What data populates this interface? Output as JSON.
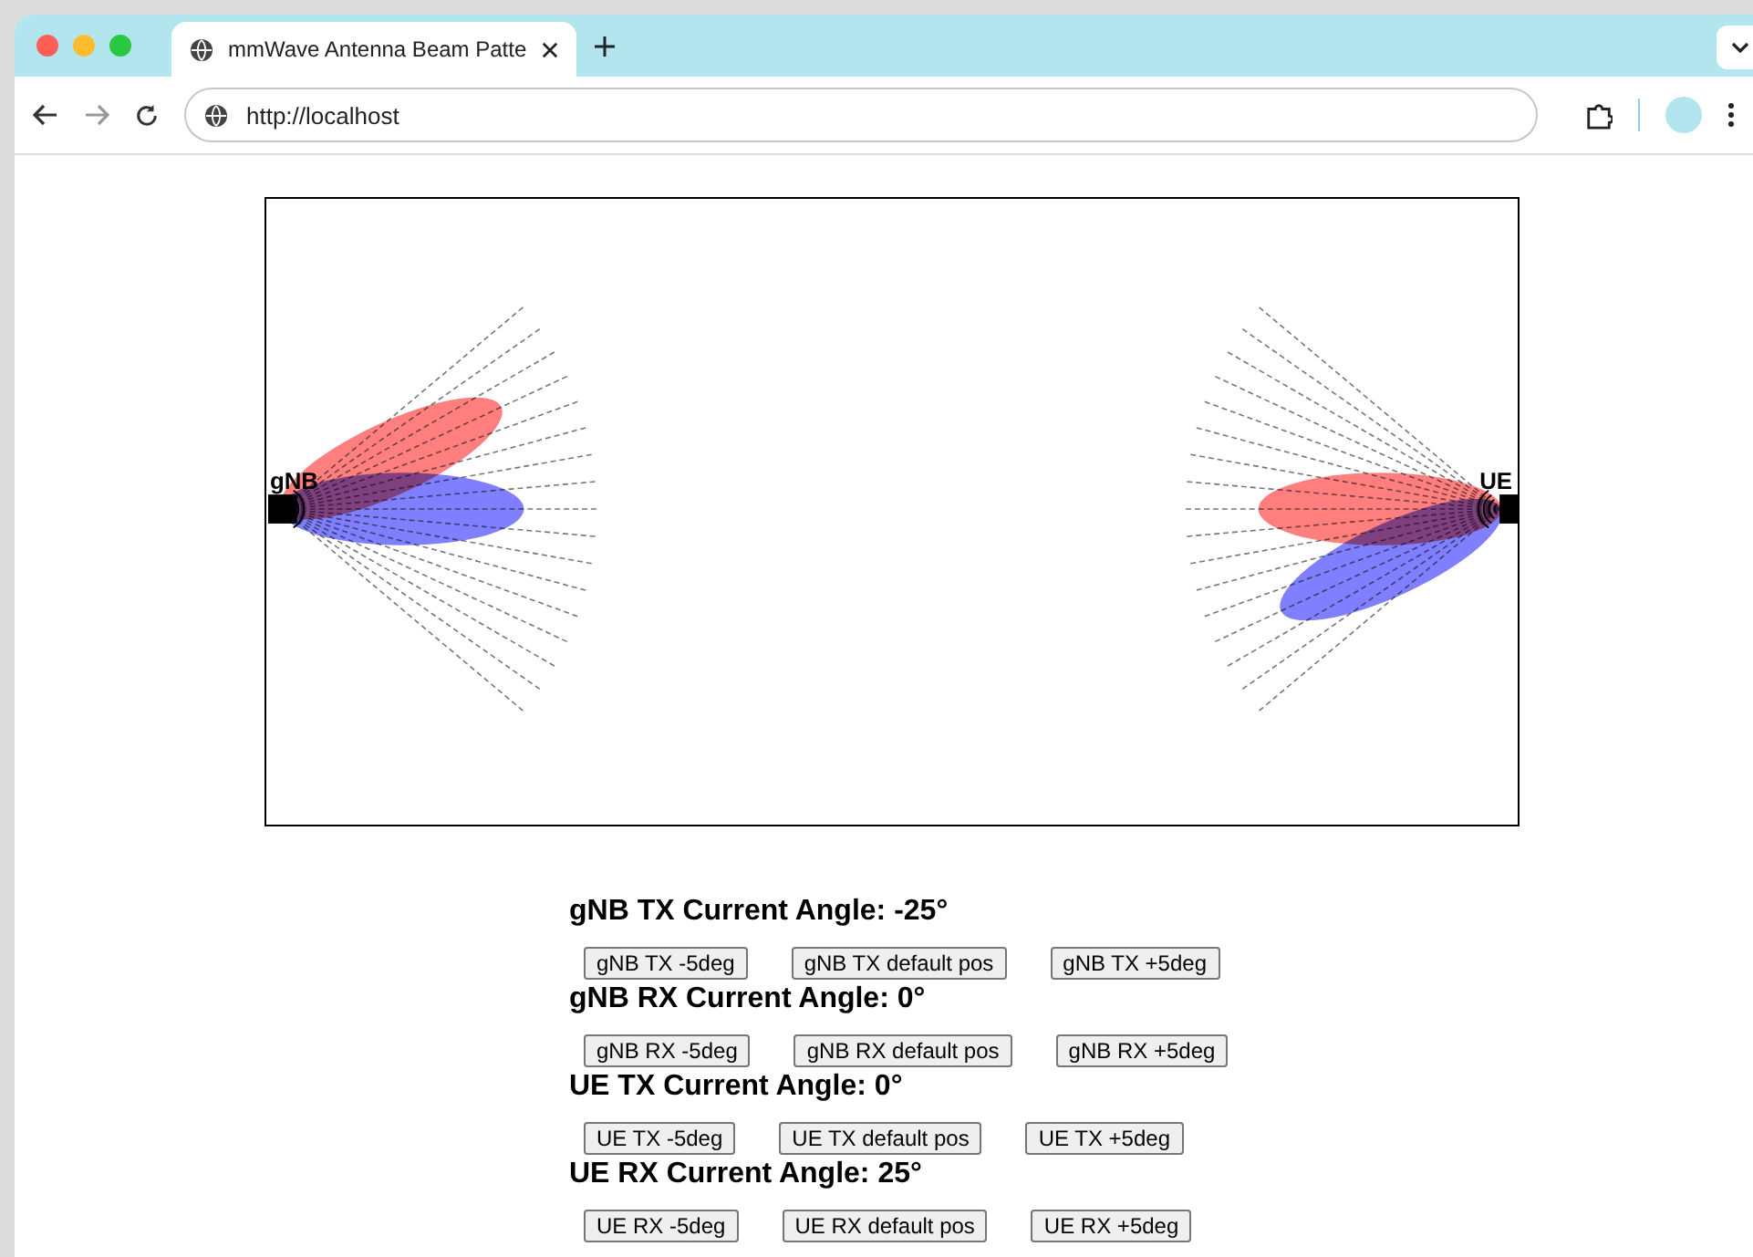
{
  "browser": {
    "tab_title": "mmWave Antenna Beam Patte",
    "url": "http://localhost"
  },
  "diagram": {
    "nodes": [
      {
        "label": "gNB"
      },
      {
        "label": "UE"
      }
    ]
  },
  "controls": [
    {
      "heading": "gNB TX Current Angle: -25°",
      "color": "#ff7f7f",
      "buttons": [
        "gNB TX -5deg",
        "gNB TX default pos",
        "gNB TX +5deg"
      ]
    },
    {
      "heading": "gNB RX Current Angle: 0°",
      "color": "#7f7fff",
      "buttons": [
        "gNB RX -5deg",
        "gNB RX default pos",
        "gNB RX +5deg"
      ]
    },
    {
      "heading": "UE TX Current Angle: 0°",
      "color": "#ff7f7f",
      "buttons": [
        "UE TX -5deg",
        "UE TX default pos",
        "UE TX +5deg"
      ]
    },
    {
      "heading": "UE RX Current Angle: 25°",
      "color": "#7f7fff",
      "buttons": [
        "UE RX -5deg",
        "UE RX default pos",
        "UE RX +5deg"
      ]
    }
  ]
}
